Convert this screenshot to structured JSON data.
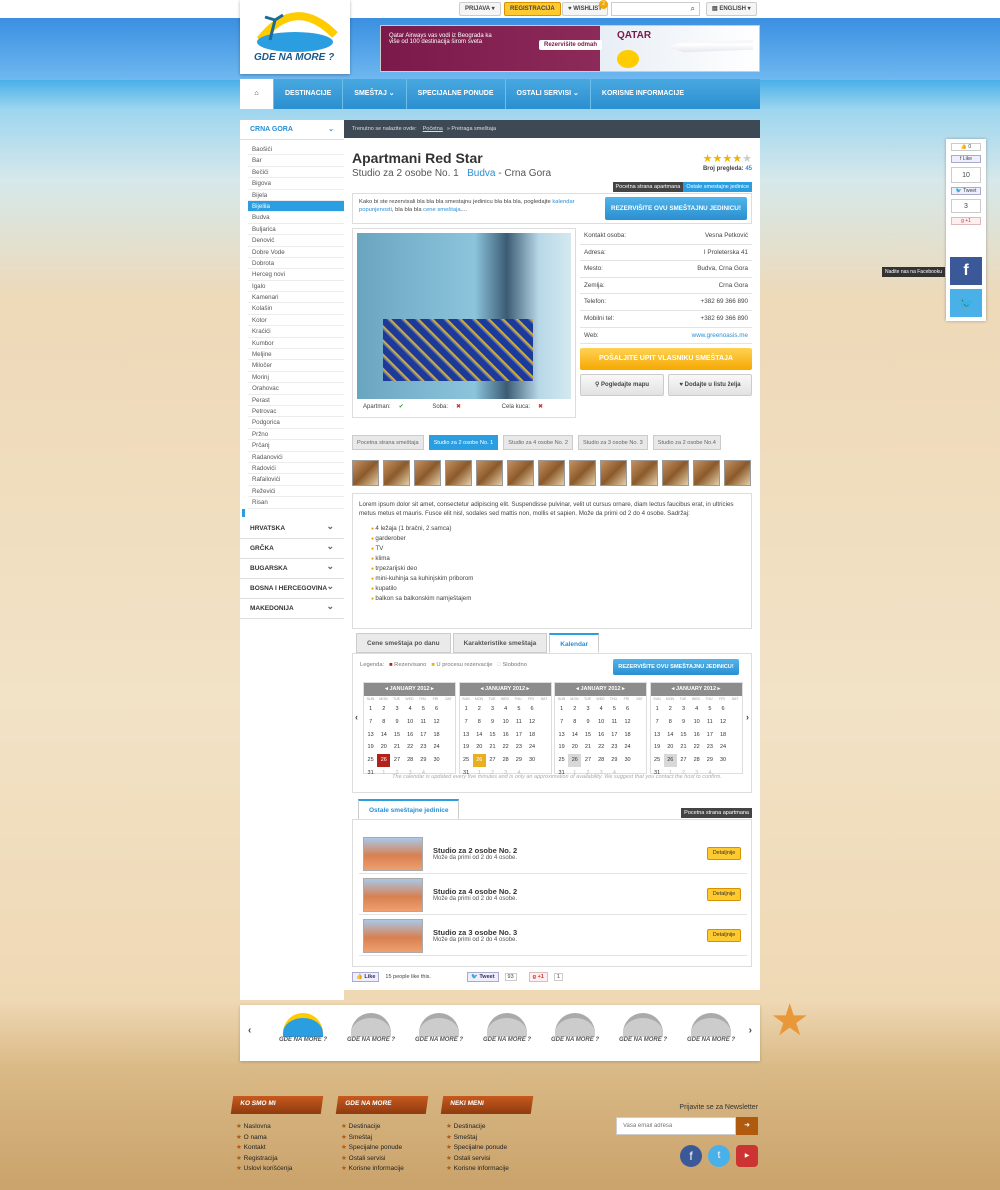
{
  "topbar": {
    "login": "PRIJAVA",
    "register": "REGISTRACIJA",
    "wishlist": "WISHLIST",
    "wishlist_count": "2",
    "language": "ENGLISH"
  },
  "logo": {
    "text": "GDE NA MORE ?"
  },
  "banner": {
    "line1": "Qatar Airways vas vodi iz Beograda ka",
    "line2": "više od 100 destinacija širom sveta",
    "cta": "Rezervišite odmah",
    "brand": "QATAR"
  },
  "nav": {
    "items": [
      "DESTINACIJE",
      "SMEŠTAJ",
      "SPECIJALNE PONUDE",
      "OSTALI SERVISI",
      "KORISNE INFORMACIJE"
    ]
  },
  "sidebar": {
    "region": "CRNA GORA",
    "places": [
      "Baošići",
      "Bar",
      "Bečići",
      "Bigova",
      "Bijela",
      "Bijelila",
      "Budva",
      "Buljarica",
      "Denović",
      "Dobre Vode",
      "Dobrota",
      "Herceg novi",
      "Igalo",
      "Kamenari",
      "Kolašin",
      "Kotor",
      "Kraćići",
      "Kumbor",
      "Meljine",
      "Miločer",
      "Morinj",
      "Orahovac",
      "Perast",
      "Petrovac",
      "Podgorica",
      "Pržno",
      "Prčanj",
      "Radanovići",
      "Radovići",
      "Rafailovići",
      "Reževići",
      "Risan"
    ],
    "selected_index": 5,
    "regions": [
      "HRVATSKA",
      "GRČKA",
      "BUGARSKA",
      "BOSNA I HERCEGOVINA",
      "MAKEDONIJA"
    ]
  },
  "breadcrumb": {
    "prefix": "Trenutno se nalazite ovde:",
    "home": "Početna",
    "current": "Pretraga smeštaja"
  },
  "listing": {
    "title": "Apartmani Red Star",
    "subtitle": "Studio za 2 osobe No. 1",
    "city": "Budva",
    "country": "Crna Gora",
    "rating": 4,
    "views_label": "Broj pregleda:",
    "views": "45",
    "tag1": "Pocetna strana apartmana",
    "tag2": "Ostale smestajne jedinice",
    "reserve_text1": "Kako bi ste rezervisali bla bla bla smestajnu jedinicu bla bla bla, pogledajte",
    "reserve_link1": "kalendar popunjenosti",
    "reserve_text2": ", bla bla bla",
    "reserve_link2": "cene smeštaja",
    "reserve_text3": "....",
    "reserve_button": "REZERVIŠITE OVU SMEŠTAJNU JEDINICU!",
    "amenities": [
      {
        "label": "Apartman:",
        "value": "✔"
      },
      {
        "label": "Soba:",
        "value": "✖"
      },
      {
        "label": "Cela kuca:",
        "value": "✖"
      }
    ],
    "contact": [
      {
        "label": "Kontakt osoba:",
        "value": "Vesna Petković"
      },
      {
        "label": "Adresa:",
        "value": "I Proleterska 41"
      },
      {
        "label": "Mesto:",
        "value": "Budva, Crna Gora"
      },
      {
        "label": "Zemlja:",
        "value": "Crna Gora"
      },
      {
        "label": "Telefon:",
        "value": "+382 69 366 890"
      },
      {
        "label": "Mobilni tel:",
        "value": "+382 69 366 890"
      },
      {
        "label": "Web:",
        "value": "www.greenoasis.me"
      }
    ],
    "inquiry_button": "POŠALJITE UPIT VLASNIKU SMEŠTAJA",
    "map_button": "Pogledajte mapu",
    "wish_button": "Dodajte u listu želja"
  },
  "unit_tabs": [
    "Pocetna strana smeštaja",
    "Studio za 2 osobe No. 1",
    "Studio za 4 osobe No. 2",
    "Studio za 3 osobe No. 3",
    "Studio za 2 osobe No.4"
  ],
  "description": {
    "text": "Lorem ipsum dolor sit amet, consectetur adipiscing elit. Suspendisse pulvinar, velit ut cursus ornare, diam lectus faucibus erat, in ultricies metus metus et mauris. Fusce elit nisl, sodales sed mattis non, mollis et sapien. Može da primi od 2 do 4 osobe. Sadržaj:",
    "items": [
      "4 ležaja (1 bračni, 2 samca)",
      "garderober",
      "TV",
      "klima",
      "trpezarijski deo",
      "mini-kuhinja sa kuhinjskim priborom",
      "kupatilo",
      "balkon sa balkonskim namještajem"
    ]
  },
  "info_tabs": [
    "Cene smeštaja po danu",
    "Karakteristike smeštaja",
    "Kalendar"
  ],
  "calendar": {
    "legend_label": "Legenda:",
    "legend": [
      "Rezervisano",
      "U procesu rezervacije",
      "Slobodno"
    ],
    "reserve_button": "REZERVIŠITE OVU SMEŠTAJNU JEDINICU!",
    "weekdays": [
      "SUN",
      "MON",
      "TUE",
      "WED",
      "THU",
      "FRI",
      "SAT"
    ],
    "months": [
      "JANUARY 2012",
      "JANUARY 2012",
      "JANUARY 2012",
      "JANUARY 2012"
    ],
    "note": "The calendar is updated every five minutes and is only an approximation of availability. We suggest that you contact the host to confirm."
  },
  "other_units": {
    "tab": "Ostale smeštajne jedinice",
    "tag": "Pocetna strana apartmana",
    "detail_label": "Detaljnije",
    "items": [
      {
        "title": "Studio za 2 osobe No. 2",
        "desc": "Može da primi od 2 do 4 osobe."
      },
      {
        "title": "Studio za 4 osobe No. 2",
        "desc": "Može da primi od 2 do 4 osobe."
      },
      {
        "title": "Studio za 3 osobe No. 3",
        "desc": "Može da primi od 2 do 4 osobe."
      }
    ]
  },
  "share": {
    "like": "Like",
    "like_text": "15 people like this.",
    "tweet": "Tweet",
    "tweet_count": "93",
    "gplus": "+1",
    "gplus_count": "1"
  },
  "right_social": {
    "like_count": "0",
    "like": "Like",
    "count1": "10",
    "tweet": "Tweet",
    "count2": "3",
    "gplus": "+1",
    "fb_tip": "Nadite nas na Facebooku"
  },
  "footer": {
    "cols": [
      {
        "title": "KO SMO MI",
        "items": [
          "Naslovna",
          "O nama",
          "Kontakt",
          "Registracija",
          "Uslovi korišćenja"
        ]
      },
      {
        "title": "GDE NA MORE",
        "items": [
          "Destinacije",
          "Smeštaj",
          "Specijalne ponude",
          "Ostali servisi",
          "Korisne informacije"
        ]
      },
      {
        "title": "NEKI MENI",
        "items": [
          "Destinacije",
          "Smeštaj",
          "Specijalne ponude",
          "Ostali servisi",
          "Korisne informacije"
        ]
      }
    ],
    "newsletter_title": "Prijavite se za Newsletter",
    "newsletter_placeholder": "Vasa email adresa"
  }
}
